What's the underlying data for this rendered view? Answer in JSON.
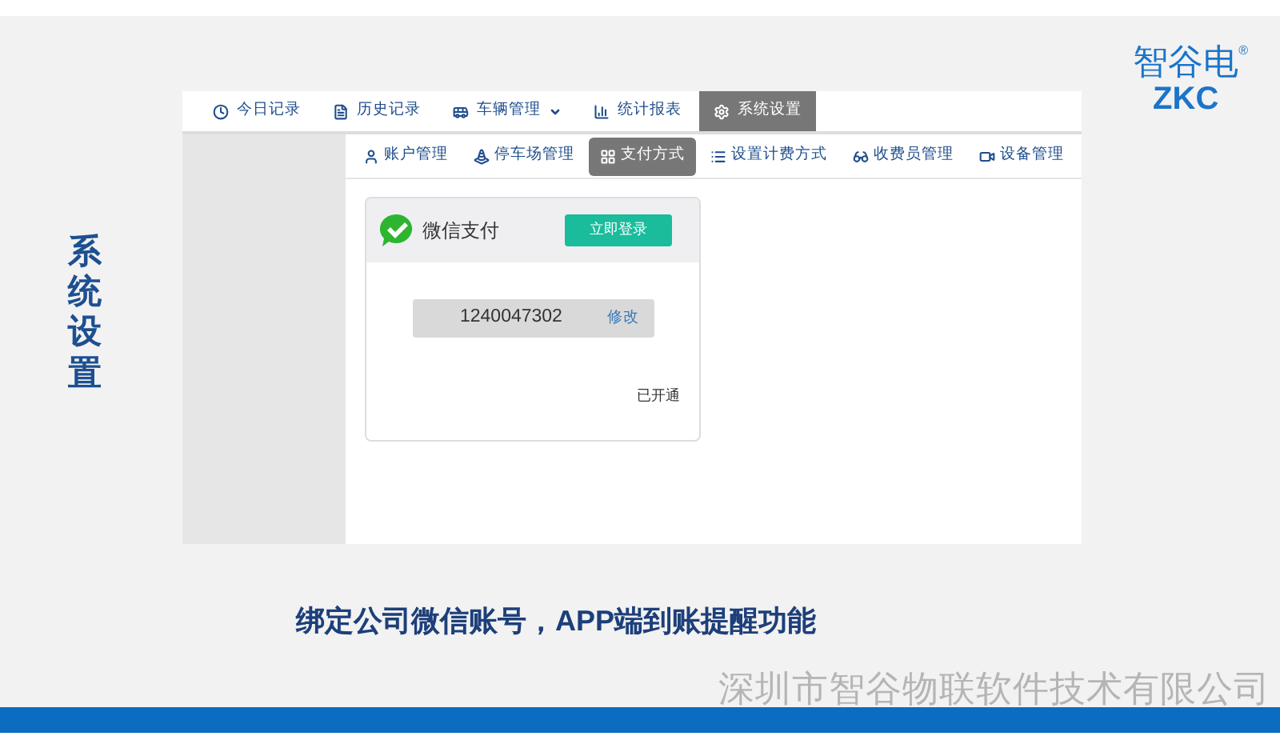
{
  "side_title": "系统设置",
  "logo": {
    "name": "智谷电",
    "letters": "ZKC",
    "mark": "®"
  },
  "nav": [
    {
      "kind": "clock",
      "label": "今日记录",
      "selected": false,
      "has_menu": false
    },
    {
      "kind": "history",
      "label": "历史记录",
      "selected": false,
      "has_menu": false
    },
    {
      "kind": "car",
      "label": "车辆管理",
      "selected": false,
      "has_menu": true
    },
    {
      "kind": "chart",
      "label": "统计报表",
      "selected": false,
      "has_menu": false
    },
    {
      "kind": "gear",
      "label": "系统设置",
      "selected": true,
      "has_menu": false
    }
  ],
  "subnav": [
    {
      "kind": "user",
      "label": "账户管理",
      "selected": false
    },
    {
      "kind": "road",
      "label": "停车场管理",
      "selected": false
    },
    {
      "kind": "grid",
      "label": "支付方式",
      "selected": true
    },
    {
      "kind": "list",
      "label": "设置计费方式",
      "selected": false
    },
    {
      "kind": "glasses",
      "label": "收费员管理",
      "selected": false
    },
    {
      "kind": "video",
      "label": "设备管理",
      "selected": false
    }
  ],
  "payment_card": {
    "title": "微信支付",
    "login_button": "立即登录",
    "account": "1240047302",
    "edit_link": "修改",
    "status": "已开通"
  },
  "caption": "绑定公司微信账号，APP端到账提醒功能",
  "company": "深圳市智谷物联软件技术有限公司"
}
